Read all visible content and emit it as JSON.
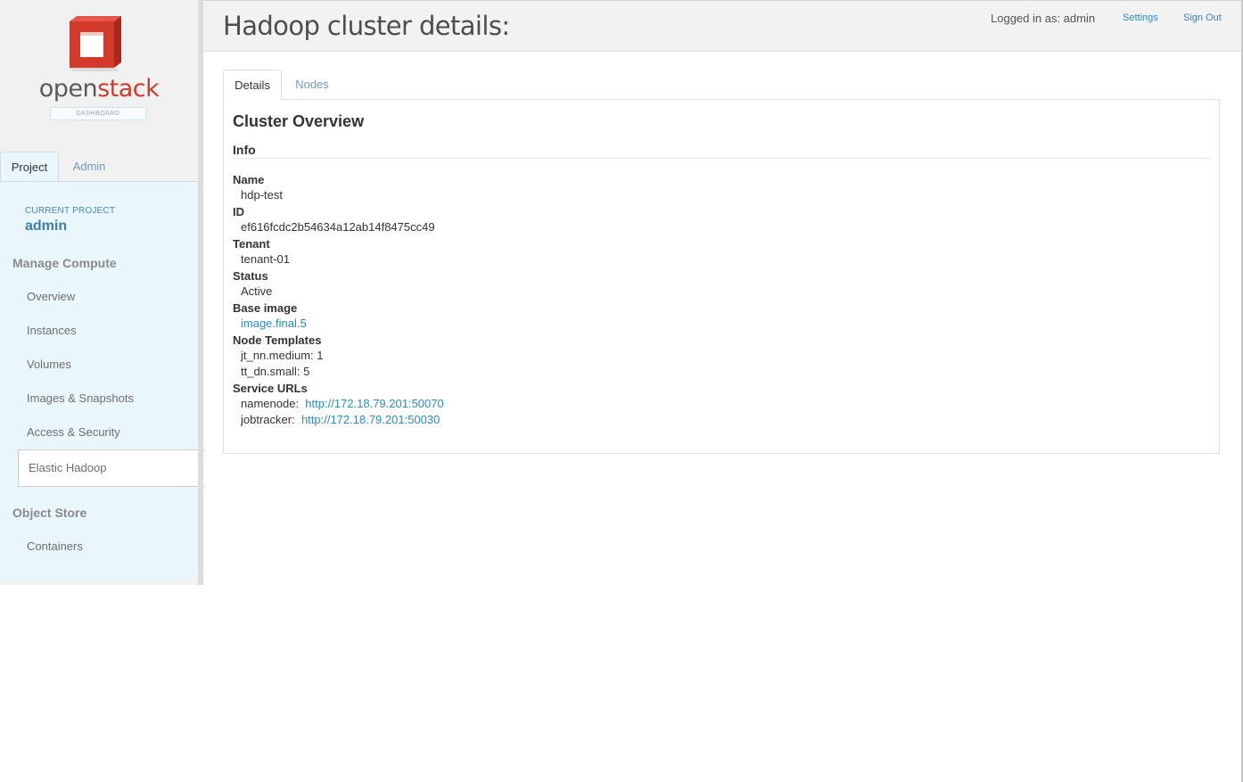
{
  "brand": {
    "logo_open": "open",
    "logo_stack": "stack",
    "logo_sub": "DASHBOARD"
  },
  "dashboard_tabs": {
    "project": "Project",
    "admin": "Admin"
  },
  "sidebar": {
    "current_project_label": "CURRENT PROJECT",
    "current_project_name": "admin",
    "manage_compute": "Manage Compute",
    "items": [
      "Overview",
      "Instances",
      "Volumes",
      "Images & Snapshots",
      "Access & Security",
      "Elastic Hadoop"
    ],
    "active_item": "Elastic Hadoop",
    "object_store": "Object Store",
    "object_items": [
      "Containers"
    ]
  },
  "header": {
    "title": "Hadoop cluster details:",
    "logged_in": "Logged in as: admin",
    "settings": "Settings",
    "sign_out": "Sign Out"
  },
  "tabs": {
    "details": "Details",
    "nodes": "Nodes"
  },
  "overview": {
    "title": "Cluster Overview",
    "info_heading": "Info",
    "name_label": "Name",
    "name": "hdp-test",
    "id_label": "ID",
    "id": "ef616fcdc2b54634a12ab14f8475cc49",
    "tenant_label": "Tenant",
    "tenant": "tenant-01",
    "status_label": "Status",
    "status": "Active",
    "base_image_label": "Base image",
    "base_image": "image.final.5",
    "node_templates_label": "Node Templates",
    "node_templates": [
      "jt_nn.medium: 1",
      "tt_dn.small: 5"
    ],
    "service_urls_label": "Service URLs",
    "namenode_label": "namenode:",
    "namenode_url": "http://172.18.79.201:50070",
    "jobtracker_label": "jobtracker:",
    "jobtracker_url": "http://172.18.79.201:50030"
  },
  "colors": {
    "link": "#2a8bc8",
    "logo_red": "#d23a2b",
    "sidebar_bg": "#e9f6fc"
  },
  "icons": {
    "logo": "openstack-logo-cube"
  }
}
